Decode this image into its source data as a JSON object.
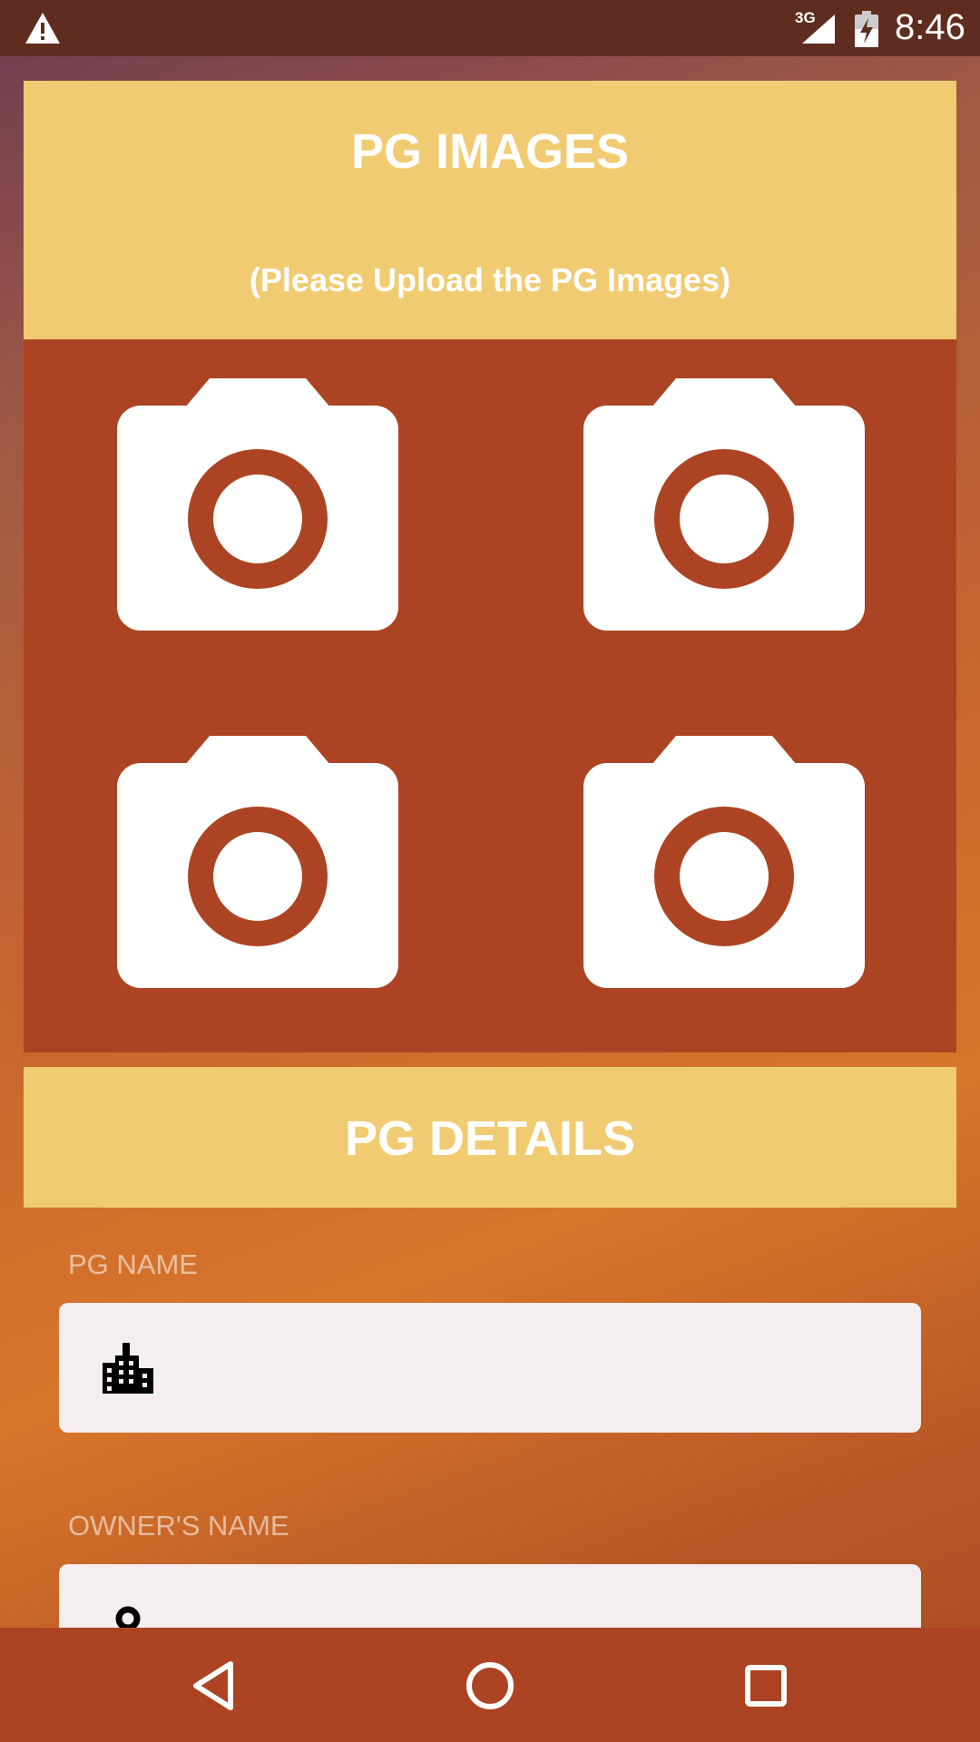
{
  "status_bar": {
    "network_type": "3G",
    "time": "8:46",
    "icons": [
      "warning-icon",
      "signal-icon",
      "battery-charging-icon"
    ]
  },
  "images_section": {
    "title": "PG IMAGES",
    "subtitle": "(Please Upload the PG Images)",
    "upload_buttons": [
      "camera-icon",
      "camera-icon",
      "camera-icon",
      "camera-icon"
    ]
  },
  "details_section": {
    "title": "PG DETAILS",
    "fields": [
      {
        "label": "PG NAME",
        "value": "",
        "icon": "building-icon"
      },
      {
        "label": "OWNER'S NAME",
        "value": "",
        "icon": "person-icon"
      }
    ]
  },
  "nav_bar": {
    "icons": [
      "back-icon",
      "home-icon",
      "recents-icon"
    ]
  },
  "colors": {
    "status_bar": "#5f2d1f",
    "header_yellow": "#f1cb71",
    "images_area": "#ac4423",
    "field_bg": "#f5eef1",
    "nav_bar": "#ac4423"
  }
}
